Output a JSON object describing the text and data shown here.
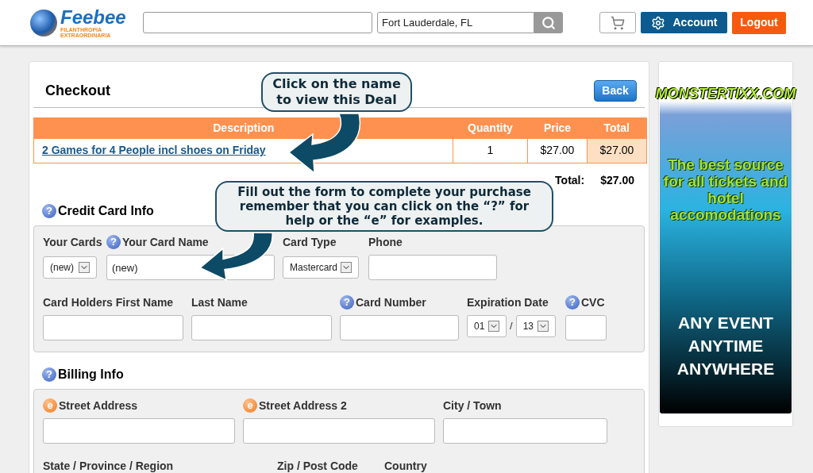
{
  "header": {
    "logo": {
      "name": "Feebee",
      "tagline_1": "FILANTHROPIA",
      "tagline_2": "EXTRAORDINARIA"
    },
    "location": {
      "value": "Fort Lauderdale, FL"
    },
    "account": "Account",
    "logout": "Logout"
  },
  "checkout": {
    "title": "Checkout",
    "back": "Back",
    "columns": [
      "Description",
      "Quantity",
      "Price",
      "Total"
    ],
    "rows": [
      {
        "description": "2 Games for 4 People incl shoes on Friday",
        "quantity": "1",
        "price": "$27.00",
        "total": "$27.00"
      }
    ],
    "total_label": "Total:",
    "total_value": "$27.00"
  },
  "callouts": [
    "Click on the name to view this Deal",
    "Fill out the form to complete your purchase remember that you can click on the “?” for help or the “e” for examples."
  ],
  "credit_card": {
    "title": "Credit Card Info",
    "hint": {
      "kind": "help",
      "glyph": "?"
    },
    "rows": [
      {
        "fields": [
          {
            "label": "Your Cards",
            "kind": "select",
            "value": "(new)"
          },
          {
            "label": "Your Card Name",
            "kind": "text",
            "value": "(new)",
            "hint": {
              "kind": "help",
              "glyph": "?"
            }
          },
          {
            "label": "Card Type",
            "kind": "select",
            "value": "Mastercard"
          },
          {
            "label": "Phone",
            "kind": "text"
          }
        ]
      },
      {
        "fields": [
          {
            "label": "Card Holders First Name",
            "kind": "text"
          },
          {
            "label": "Last Name",
            "kind": "text"
          },
          {
            "label": "Card Number",
            "kind": "text",
            "hint": {
              "kind": "help",
              "glyph": "?"
            }
          },
          {
            "label": "Expiration Date",
            "kind": "date",
            "month": "01",
            "separator": "/",
            "year": "13"
          },
          {
            "label": "CVC",
            "kind": "text",
            "hint": {
              "kind": "help",
              "glyph": "?"
            }
          }
        ]
      }
    ]
  },
  "billing": {
    "title": "Billing Info",
    "hint": {
      "kind": "help",
      "glyph": "?"
    },
    "rows": [
      {
        "fields": [
          {
            "label": "Street Address",
            "kind": "text",
            "hint": {
              "kind": "example",
              "glyph": "e"
            }
          },
          {
            "label": "Street Address 2",
            "kind": "text",
            "hint": {
              "kind": "example",
              "glyph": "e"
            }
          },
          {
            "label": "City / Town",
            "kind": "text"
          }
        ]
      },
      {
        "fields": [
          {
            "label": "State / Province / Region",
            "kind": "label"
          },
          {
            "label": "Zip / Post Code",
            "kind": "label"
          },
          {
            "label": "Country",
            "kind": "label"
          }
        ]
      }
    ]
  },
  "ad": {
    "brand": "MONSTERTIXX.COM",
    "tagline": "The best source for all tickets and hotel accomodations",
    "slogan": [
      "ANY EVENT",
      "ANYTIME",
      "ANYWHERE"
    ]
  }
}
